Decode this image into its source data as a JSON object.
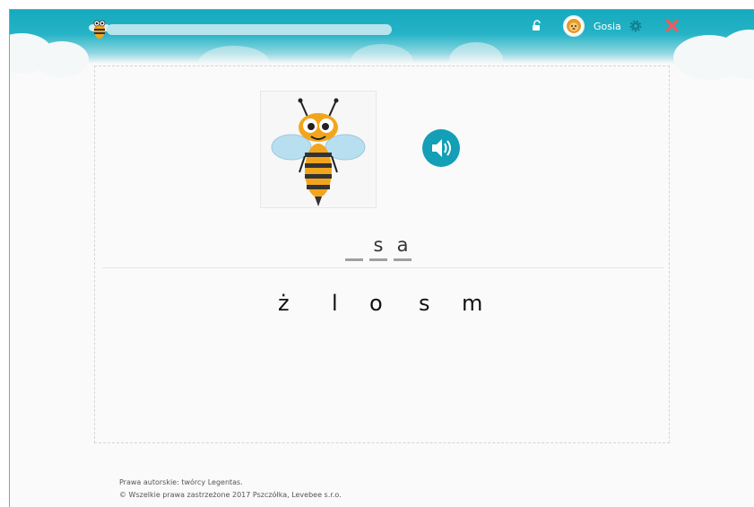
{
  "header": {
    "progress": 0,
    "username": "Gosia"
  },
  "exercise": {
    "slots": [
      "",
      "s",
      "a"
    ],
    "letters": [
      "ż",
      "l",
      "o",
      "s",
      "m"
    ]
  },
  "footer": {
    "line1": "Prawa autorskie: twórcy Legentas.",
    "line2": "© Wszelkie prawa zastrzeżone 2017 Pszczółka, Levebee s.r.o."
  },
  "icons": {
    "logo": "bee-logo-icon",
    "lock": "unlock-icon",
    "avatar": "lion-avatar-icon",
    "settings": "gear-icon",
    "close": "close-icon",
    "sound": "speaker-icon"
  },
  "colors": {
    "header": "#16a9bd",
    "accent": "#139fb5",
    "close": "#f05a5a",
    "gear": "#0e7f8e"
  }
}
